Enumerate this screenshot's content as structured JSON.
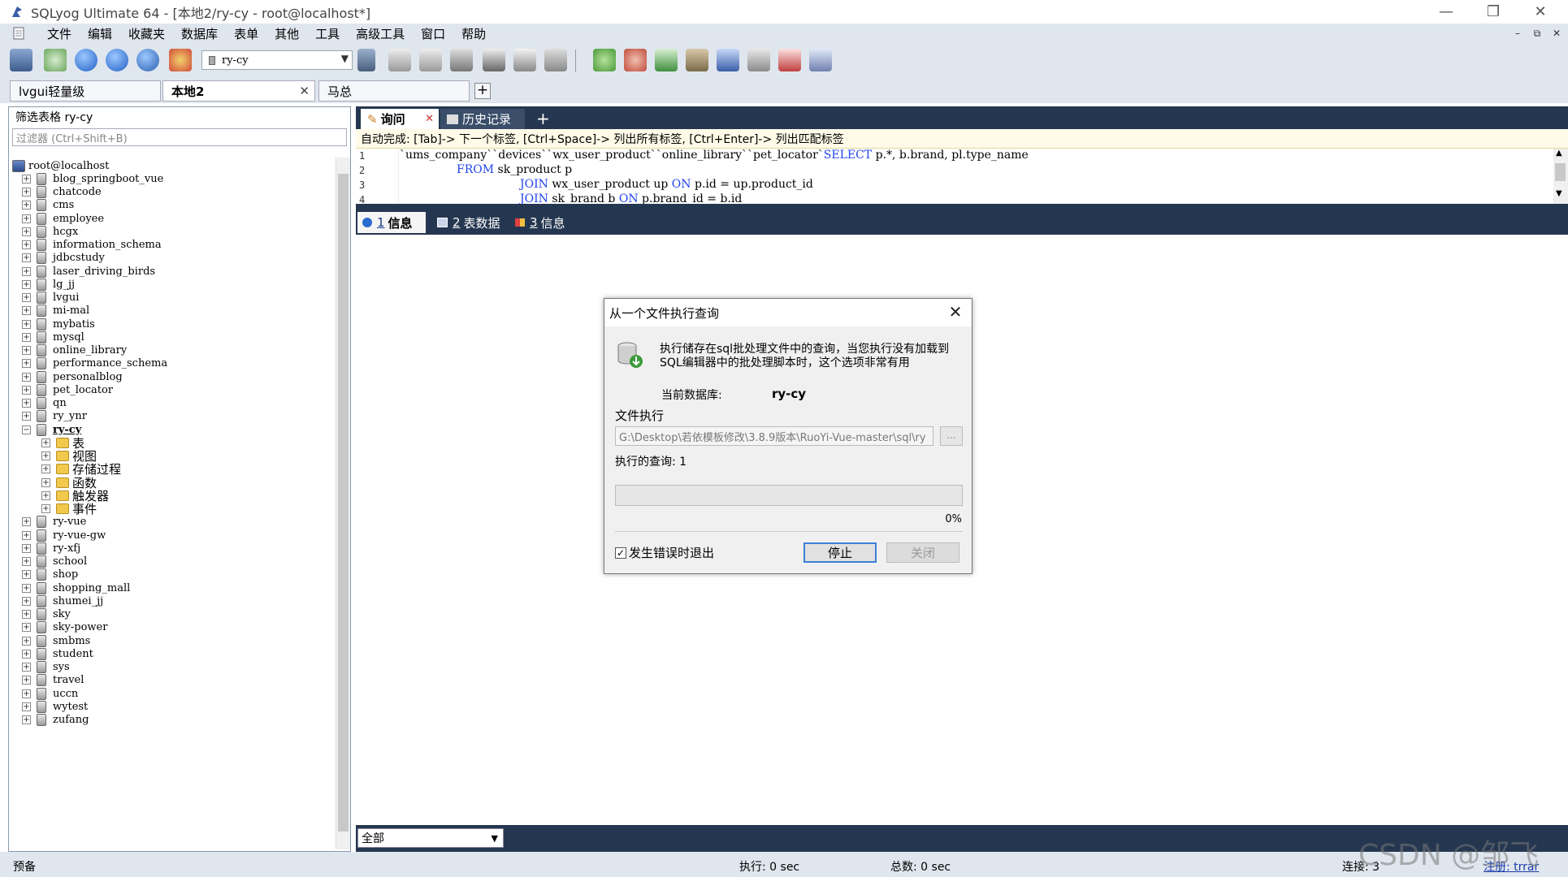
{
  "window": {
    "title": "SQLyog Ultimate 64 - [本地2/ry-cy - root@localhost*]",
    "minimize": "—",
    "restore": "❐",
    "close": "✕"
  },
  "menu": [
    "文件",
    "编辑",
    "收藏夹",
    "数据库",
    "表单",
    "其他",
    "工具",
    "高级工具",
    "窗口",
    "帮助"
  ],
  "mdi_controls": [
    "–",
    "⧉",
    "✕"
  ],
  "toolbar": {
    "db_select": "ry-cy"
  },
  "connection_tabs": [
    {
      "label": "lvgui轻量级"
    },
    {
      "label": "本地2",
      "close": "✕"
    },
    {
      "label": "马总"
    }
  ],
  "connection_add": "+",
  "left_panel": {
    "filter_label": "筛选表格 ry-cy",
    "filter_placeholder": "过滤器 (Ctrl+Shift+B)",
    "root": "root@localhost",
    "databases_before": [
      "blog_springboot_vue",
      "chatcode",
      "cms",
      "employee",
      "hcgx",
      "information_schema",
      "jdbcstudy",
      "laser_driving_birds",
      "lg_jj",
      "lvgui",
      "mi-mal",
      "mybatis",
      "mysql",
      "online_library",
      "performance_schema",
      "personalblog",
      "pet_locator",
      "qn",
      "ry_ynr"
    ],
    "expanded_db": "ry-cy",
    "children": [
      "表",
      "视图",
      "存储过程",
      "函数",
      "触发器",
      "事件"
    ],
    "databases_after": [
      "ry-vue",
      "ry-vue-gw",
      "ry-xfj",
      "school",
      "shop",
      "shopping_mall",
      "shumei_jj",
      "sky",
      "sky-power",
      "smbms",
      "student",
      "sys",
      "travel",
      "uccn",
      "wytest",
      "zufang"
    ]
  },
  "query_tabs": [
    {
      "label": "询问",
      "close": "✕"
    },
    {
      "label": "历史记录"
    }
  ],
  "query_add": "+",
  "hint": "自动完成: [Tab]-> 下一个标签, [Ctrl+Space]-> 列出所有标签, [Ctrl+Enter]-> 列出匹配标签",
  "editor": {
    "line_numbers": [
      "1",
      "2",
      "3",
      "4"
    ],
    "line1_prefix": "`ums_company``devices``wx_user_product``online_library``pet_locator`",
    "line1_kw": "SELECT",
    "line1_rest": " p.*, b.brand, pl.type_name",
    "line2_kw": "FROM",
    "line2_rest": " sk_product p",
    "line3_kw": "JOIN",
    "line3_mid": " wx_user_product up ",
    "line3_kw2": "ON",
    "line3_rest": " p.id = up.product_id",
    "line4_kw": "JOIN",
    "line4_mid": " sk_brand b ",
    "line4_kw2": "ON",
    "line4_rest": " p.brand_id = b.id"
  },
  "result_tabs": [
    {
      "num": "1",
      "label": "信息"
    },
    {
      "num": "2",
      "label": "表数据"
    },
    {
      "num": "3",
      "label": "信息"
    }
  ],
  "scope_select": "全部",
  "status": {
    "left": "预备",
    "exec": "执行: 0 sec",
    "total": "总数: 0 sec",
    "conn": "连接: 3",
    "reg": "注册: trrar"
  },
  "watermark": "CSDN @邹飞鸣",
  "dialog": {
    "title": "从一个文件执行查询",
    "close": "✕",
    "desc": "执行储存在sql批处理文件中的查询，当您执行没有加载到SQL编辑器中的批处理脚本时，这个选项非常有用",
    "current_db_label": "当前数据库:",
    "current_db_value": "ry-cy",
    "file_label": "文件执行",
    "file_path": "G:\\Desktop\\若依模板修改\\3.8.9版本\\RuoYi-Vue-master\\sql\\ry",
    "browse": "...",
    "executed": "执行的查询: 1",
    "progress": 0,
    "progress_label": "0%",
    "checkbox_label": "发生错误时退出",
    "checkbox_checked": true,
    "checkbox_mark": "✓",
    "stop": "停止",
    "close_btn": "关闭"
  }
}
